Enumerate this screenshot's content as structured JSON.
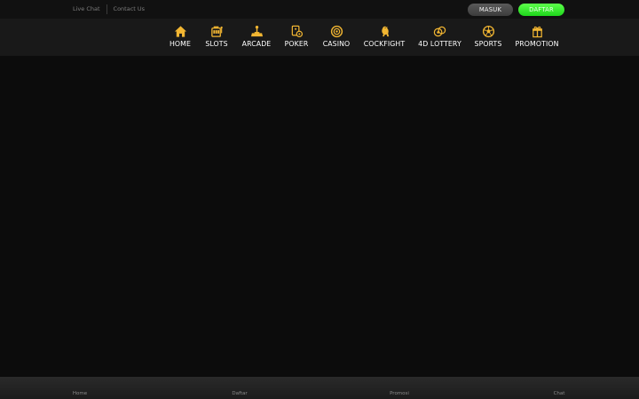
{
  "topbar": {
    "links": [
      "Live Chat",
      "Contact Us"
    ],
    "login_label": "MASUK",
    "register_label": "DAFTAR"
  },
  "nav": {
    "items": [
      {
        "label": "HOME",
        "icon": "home-icon"
      },
      {
        "label": "SLOTS",
        "icon": "slots-icon"
      },
      {
        "label": "ARCADE",
        "icon": "arcade-icon"
      },
      {
        "label": "POKER",
        "icon": "poker-icon"
      },
      {
        "label": "CASINO",
        "icon": "casino-chip-icon"
      },
      {
        "label": "COCKFIGHT",
        "icon": "rooster-icon"
      },
      {
        "label": "4D LOTTERY",
        "icon": "lottery-icon"
      },
      {
        "label": "SPORTS",
        "icon": "soccer-ball-icon"
      },
      {
        "label": "PROMOTION",
        "icon": "gift-icon"
      }
    ]
  },
  "bottom_nav": {
    "items": [
      "Home",
      "Daftar",
      "Promosi",
      "Chat"
    ]
  },
  "colors": {
    "accent_gold": "#f2b632",
    "register_green": "#34e82c",
    "background": "#0c0c0c"
  }
}
